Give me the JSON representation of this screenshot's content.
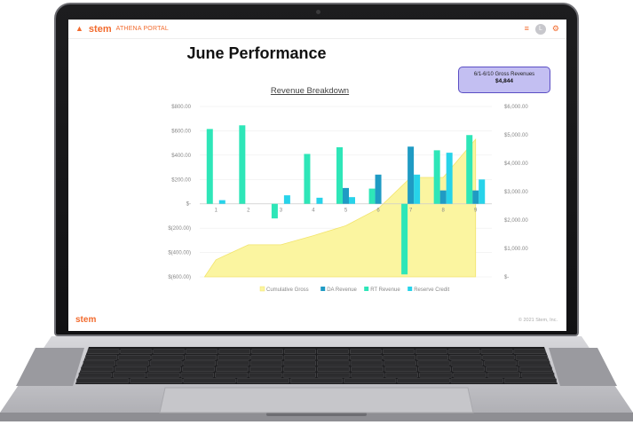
{
  "header": {
    "brand": "stem",
    "portal": "ATHENA PORTAL",
    "avatar_initial": "L",
    "icons": [
      "home-icon",
      "menu-icon",
      "gear-icon"
    ]
  },
  "page": {
    "title": "June Performance",
    "chart_title": "Revenue Breakdown"
  },
  "kpi": {
    "label": "6/1-6/10 Gross Revenues",
    "value": "$4,844"
  },
  "footer": {
    "logo": "stem",
    "copyright": "© 2021 Stem, Inc."
  },
  "colors": {
    "brand": "#f26b2e",
    "cumulative_fill": "#fbf5a0",
    "cumulative_line": "#f2e46b",
    "da": "#1f9bc4",
    "rt": "#2ee6b8",
    "reserve": "#27d3ea",
    "kpi_bg": "#c3bff2",
    "kpi_border": "#5b4ec4"
  },
  "chart_data": {
    "type": "bar",
    "title": "Revenue Breakdown",
    "categories": [
      "1",
      "2",
      "3",
      "4",
      "5",
      "6",
      "7",
      "8",
      "9"
    ],
    "left_axis": {
      "ticks": [
        "$800.00",
        "$600.00",
        "$400.00",
        "$200.00",
        "$-",
        "$(200.00)",
        "$(400.00)",
        "$(600.00)"
      ],
      "range": [
        -600,
        800
      ]
    },
    "right_axis": {
      "ticks": [
        "$6,000.00",
        "$5,000.00",
        "$4,000.00",
        "$3,000.00",
        "$2,000.00",
        "$1,000.00",
        "$-"
      ],
      "range": [
        0,
        6000
      ]
    },
    "series": [
      {
        "name": "Cumulative Gross",
        "type": "area",
        "axis": "right",
        "values": [
          600,
          1130,
          1130,
          1450,
          1800,
          2400,
          3500,
          3500,
          4844
        ]
      },
      {
        "name": "DA Revenue",
        "type": "bar",
        "axis": "left",
        "values": [
          0,
          0,
          0,
          0,
          130,
          240,
          470,
          110,
          110
        ]
      },
      {
        "name": "RT Revenue",
        "type": "bar",
        "axis": "left",
        "values": [
          615,
          645,
          -120,
          410,
          465,
          125,
          -580,
          440,
          565
        ]
      },
      {
        "name": "Reserve Credit",
        "type": "bar",
        "axis": "left",
        "values": [
          30,
          0,
          70,
          50,
          55,
          0,
          240,
          420,
          200
        ]
      }
    ],
    "legend": [
      "Cumulative Gross",
      "DA Revenue",
      "RT Revenue",
      "Reserve Credit"
    ],
    "legend_position": "bottom",
    "grid": true
  }
}
